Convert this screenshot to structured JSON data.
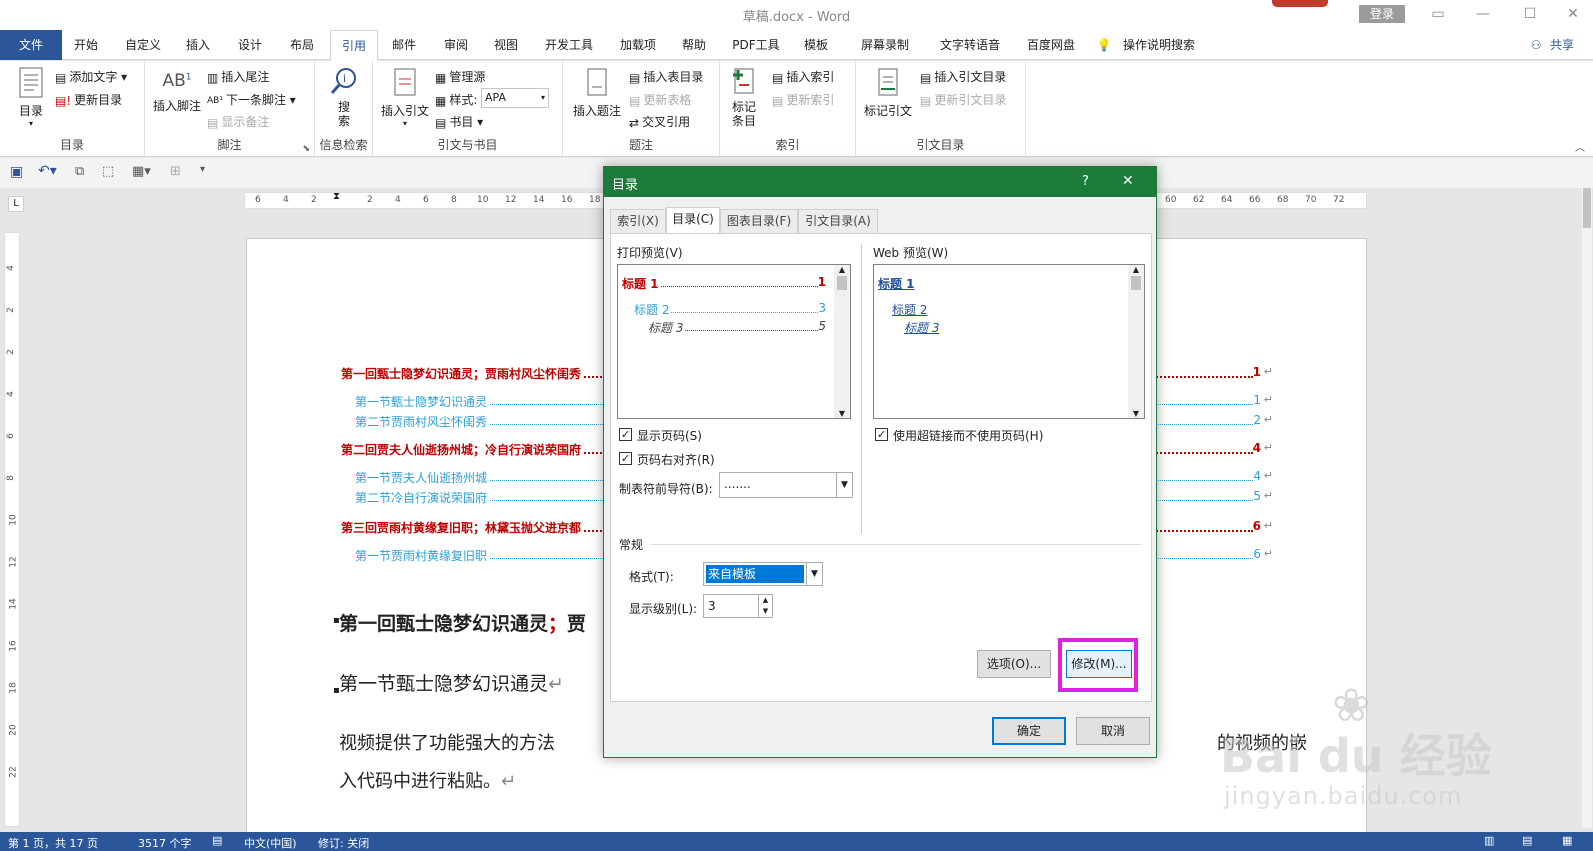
{
  "window": {
    "title": "草稿.docx - Word",
    "login": "登录"
  },
  "tabs": [
    "文件",
    "开始",
    "自定义",
    "插入",
    "设计",
    "布局",
    "引用",
    "邮件",
    "审阅",
    "视图",
    "开发工具",
    "加载项",
    "帮助",
    "PDF工具",
    "模板",
    "屏幕录制",
    "文字转语音",
    "百度网盘",
    "操作说明搜索"
  ],
  "share": "共享",
  "ribbon": {
    "toc": {
      "big": "目录",
      "add_text": "添加文字",
      "update": "更新目录",
      "label": "目录"
    },
    "footnote": {
      "insert": "插入脚注",
      "endnote": "插入尾注",
      "next": "下一条脚注",
      "show": "显示备注",
      "label": "脚注"
    },
    "research": {
      "search": "搜\n索",
      "label": "信息检索"
    },
    "citation": {
      "insert": "插入引文",
      "manage": "管理源",
      "style_label": "样式:",
      "style_value": "APA",
      "biblio": "书目",
      "label": "引文与书目"
    },
    "caption": {
      "insert": "插入题注",
      "insert_table": "插入表目录",
      "update_table": "更新表格",
      "cross": "交叉引用",
      "label": "题注"
    },
    "index": {
      "mark": "标记\n条目",
      "insert": "插入索引",
      "update": "更新索引",
      "label": "索引"
    },
    "toa": {
      "mark": "标记引文",
      "insert": "插入引文目录",
      "update": "更新引文目录",
      "label": "引文目录"
    }
  },
  "ruler_numbers": [
    "6",
    "4",
    "2",
    "2",
    "4",
    "6",
    "8",
    "10",
    "12",
    "14",
    "16",
    "18",
    "60",
    "62",
    "64",
    "66",
    "68",
    "70",
    "72"
  ],
  "vruler_numbers": [
    "4",
    "2",
    "2",
    "4",
    "6",
    "8",
    "10",
    "12",
    "14",
    "16",
    "18",
    "20",
    "22"
  ],
  "document": {
    "toc": [
      {
        "level": 1,
        "text": "第一回甄士隐梦幻识通灵；贾雨村风尘怀闺秀",
        "page": "1"
      },
      {
        "level": 2,
        "text": "第一节甄士隐梦幻识通灵",
        "page": "1"
      },
      {
        "level": 2,
        "text": "第二节贾雨村风尘怀闺秀",
        "page": "2"
      },
      {
        "level": 1,
        "text": "第二回贾夫人仙逝扬州城；冷自行演说荣国府",
        "page": "4"
      },
      {
        "level": 2,
        "text": "第一节贾夫人仙逝扬州城",
        "page": "4"
      },
      {
        "level": 2,
        "text": "第二节冷自行演说荣国府",
        "page": "5"
      },
      {
        "level": 1,
        "text": "第三回贾雨村黄缘复旧职；林黛玉抛父进京都",
        "page": "6"
      },
      {
        "level": 2,
        "text": "第一节贾雨村黄缘复旧职",
        "page": "6"
      }
    ],
    "heading1": "第一回甄士隐梦幻识通灵",
    "heading1_sep": "；",
    "heading1_tail": "贾",
    "heading2": "第一节甄士隐梦幻识通灵",
    "body1_left": "视频提供了功能强大的方法",
    "body1_right": "的视频的嵌",
    "body2": "入代码中进行粘贴。",
    "para_mark": "↵"
  },
  "dialog": {
    "title": "目录",
    "help": "?",
    "close": "✕",
    "tabs": [
      "索引(X)",
      "目录(C)",
      "图表目录(F)",
      "引文目录(A)"
    ],
    "print_preview_label": "打印预览(V)",
    "web_preview_label": "Web 预览(W)",
    "print_preview": [
      {
        "text": "标题 1",
        "page": "1"
      },
      {
        "text": "标题 2",
        "page": "3"
      },
      {
        "text": "标题 3",
        "page": "5"
      }
    ],
    "web_preview": [
      "标题 1",
      "标题 2",
      "标题 3"
    ],
    "show_page_numbers": "显示页码(S)",
    "right_align": "页码右对齐(R)",
    "tab_leader_label": "制表符前导符(B):",
    "tab_leader_value": ".......",
    "use_hyperlinks": "使用超链接而不使用页码(H)",
    "general_label": "常规",
    "format_label": "格式(T):",
    "format_value": "来自模板",
    "levels_label": "显示级别(L):",
    "levels_value": "3",
    "options_button": "选项(O)...",
    "modify_button": "修改(M)...",
    "ok_button": "确定",
    "cancel_button": "取消",
    "checks": {
      "show_page_numbers": true,
      "right_align": true,
      "use_hyperlinks": true
    }
  },
  "status": {
    "page": "第 1 页，共 17 页",
    "words": "3517 个字",
    "lang": "中文(中国)",
    "track": "修订: 关闭"
  },
  "watermark": {
    "brand": "Bai du 经验",
    "url": "jingyan.baidu.com"
  },
  "colors": {
    "accent": "#2b579a",
    "dialog_title": "#1c7a3a",
    "toc1": "#c00000",
    "toc2": "#2e9fd8",
    "highlight": "#e020e0"
  }
}
